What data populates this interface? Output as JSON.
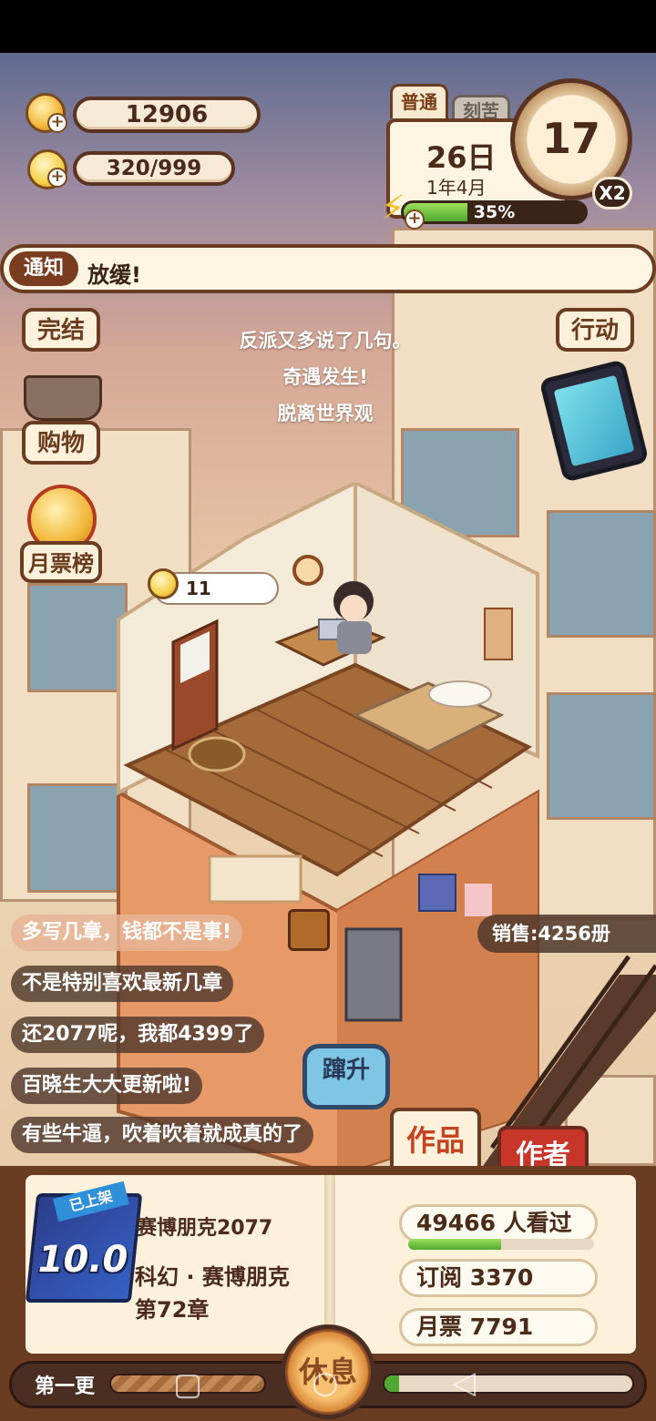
{
  "resources": {
    "coins": "12906",
    "inspiration": "320/999"
  },
  "date_card": {
    "tab_normal": "普通",
    "tab_hard": "刻苦",
    "day": "26日",
    "year_month": "1年4月",
    "energy": "35%",
    "energy_fraction": 0.35,
    "hour": "17",
    "speed": "X2"
  },
  "notice": {
    "tag": "通知",
    "text": "放缓!"
  },
  "side_buttons": {
    "finish": "完结",
    "shop": "购物",
    "monthly_rank": "月票榜",
    "action": "行动"
  },
  "events": [
    "反派又多说了几句。",
    "奇遇发生!",
    "脱离世界观"
  ],
  "inspiration_bubble": "11",
  "comments": [
    "多写几章，钱都不是事!",
    "不是特别喜欢最新几章",
    "还2077呢，我都4399了",
    "百晓生大大更新啦!",
    "有些牛逼，吹着吹着就成真的了"
  ],
  "sales": "销售:4256册",
  "rise_button": "蹿升",
  "tabs": {
    "works": "作品",
    "author": "作者"
  },
  "book": {
    "ribbon": "已上架",
    "score": "10.0",
    "title": "赛博朋克2077",
    "genre": "科幻 · 赛博朋克",
    "chapter": "第72章",
    "views": "49466  人看过",
    "views_fraction": 0.5,
    "subscriptions": "订阅  3370",
    "monthly_tickets": "月票  7791"
  },
  "bottom": {
    "first_update": "第一更",
    "rest": "休息",
    "right_progress_fraction": 0.06
  },
  "colors": {
    "frame_brown": "#6a3c22",
    "paper": "#fdf1dc",
    "green": "#4fa830",
    "author_red": "#c8362a",
    "rise_blue": "#7ec6e4"
  }
}
